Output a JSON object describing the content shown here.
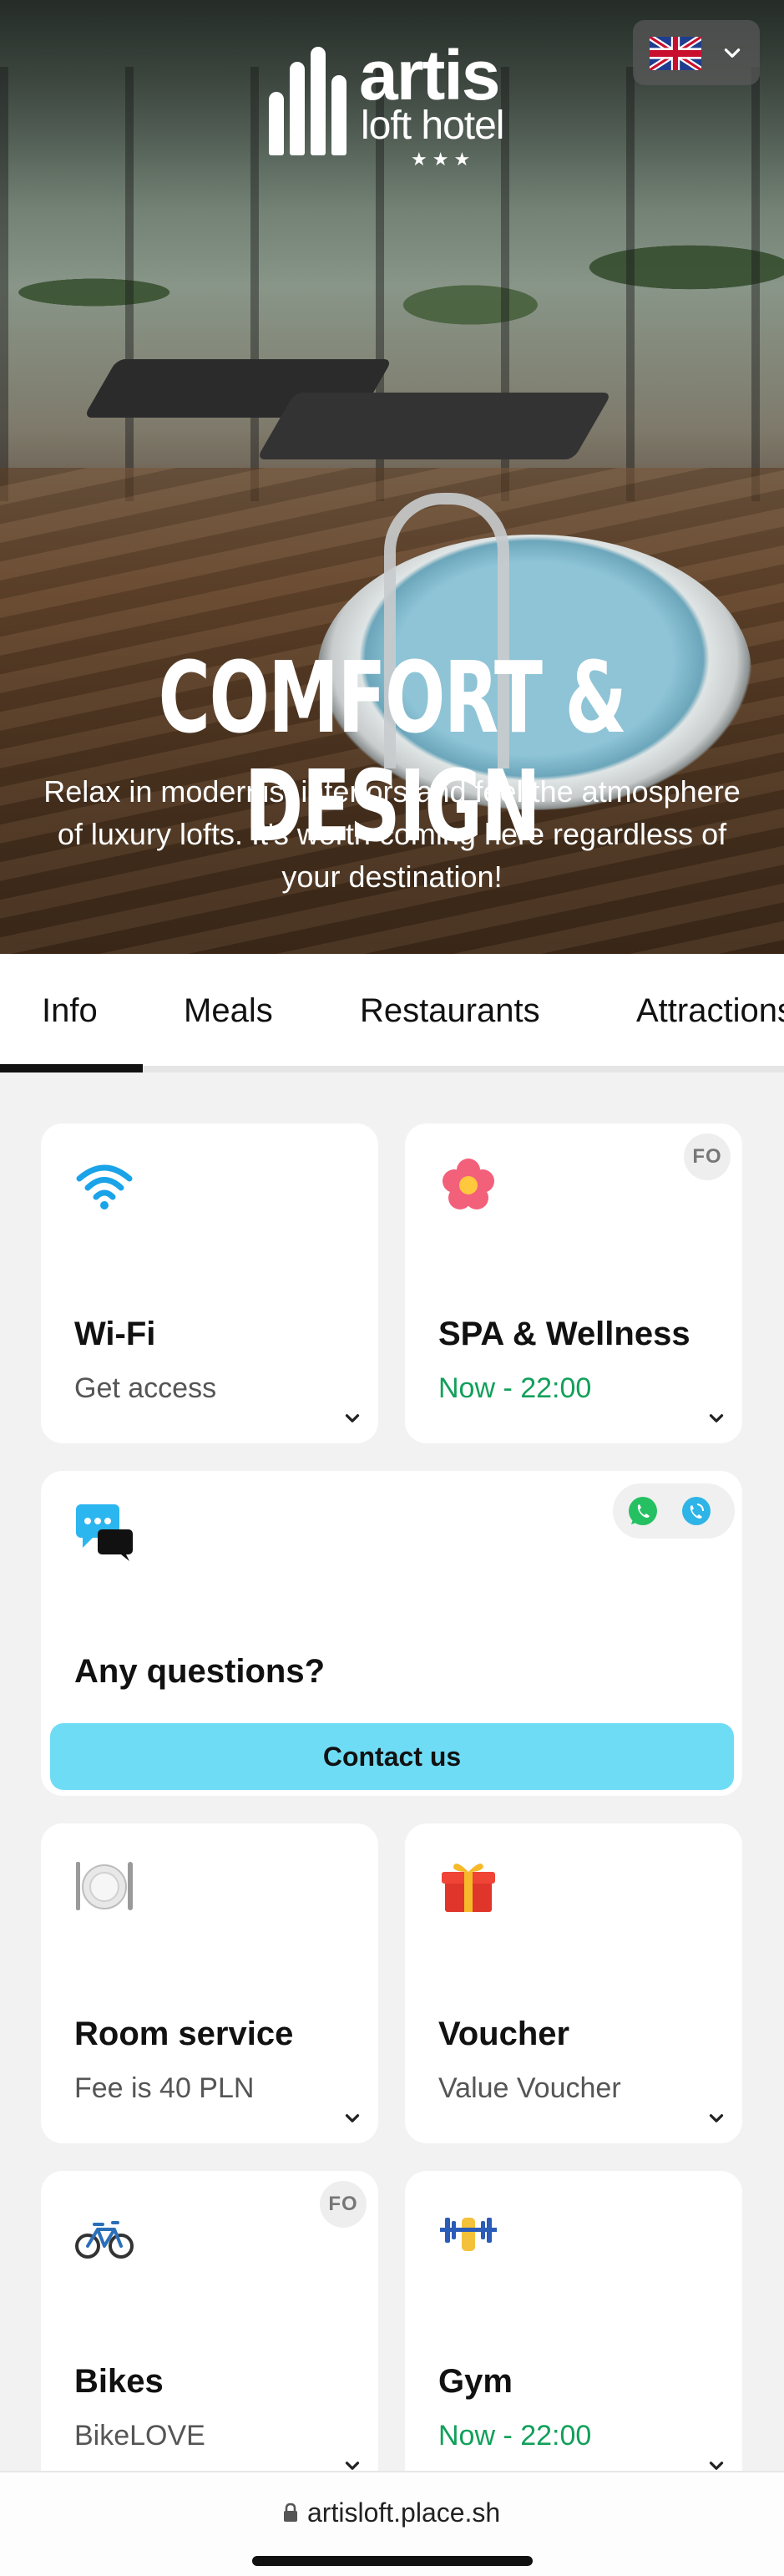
{
  "header": {
    "brand": "artis",
    "brand_sub": "loft hotel",
    "stars": "★★★",
    "language": {
      "icon": "uk-flag-icon"
    }
  },
  "hero": {
    "title": "COMFORT & DESIGN",
    "text": "Relax in modernist interiors and feel the atmosphere of luxury lofts. It's worth coming here regardless of your destination!"
  },
  "tabs": [
    {
      "label": "Info",
      "active": true
    },
    {
      "label": "Meals"
    },
    {
      "label": "Restaurants"
    },
    {
      "label": "Attractions"
    }
  ],
  "cards": {
    "wifi": {
      "title": "Wi-Fi",
      "subtitle": "Get access",
      "icon": "wifi-icon"
    },
    "spa": {
      "title": "SPA & Wellness",
      "subtitle": "Now - 22:00",
      "badge": "FO",
      "icon": "flower-icon"
    },
    "questions": {
      "title": "Any questions?",
      "button": "Contact us",
      "icon": "chat-bubbles-icon"
    },
    "room_service": {
      "title": "Room service",
      "subtitle": "Fee is 40 PLN",
      "icon": "plate-cutlery-icon"
    },
    "voucher": {
      "title": "Voucher",
      "subtitle": "Value Voucher",
      "icon": "gift-icon"
    },
    "bikes": {
      "title": "Bikes",
      "subtitle": "BikeLOVE",
      "badge": "FO",
      "icon": "bicycle-icon"
    },
    "gym": {
      "title": "Gym",
      "subtitle": "Now - 22:00",
      "icon": "dumbbell-icon"
    }
  },
  "browser": {
    "url": "artisloft.place.sh"
  },
  "colors": {
    "accent": "#6fdcf6",
    "open_green": "#11a05a"
  }
}
